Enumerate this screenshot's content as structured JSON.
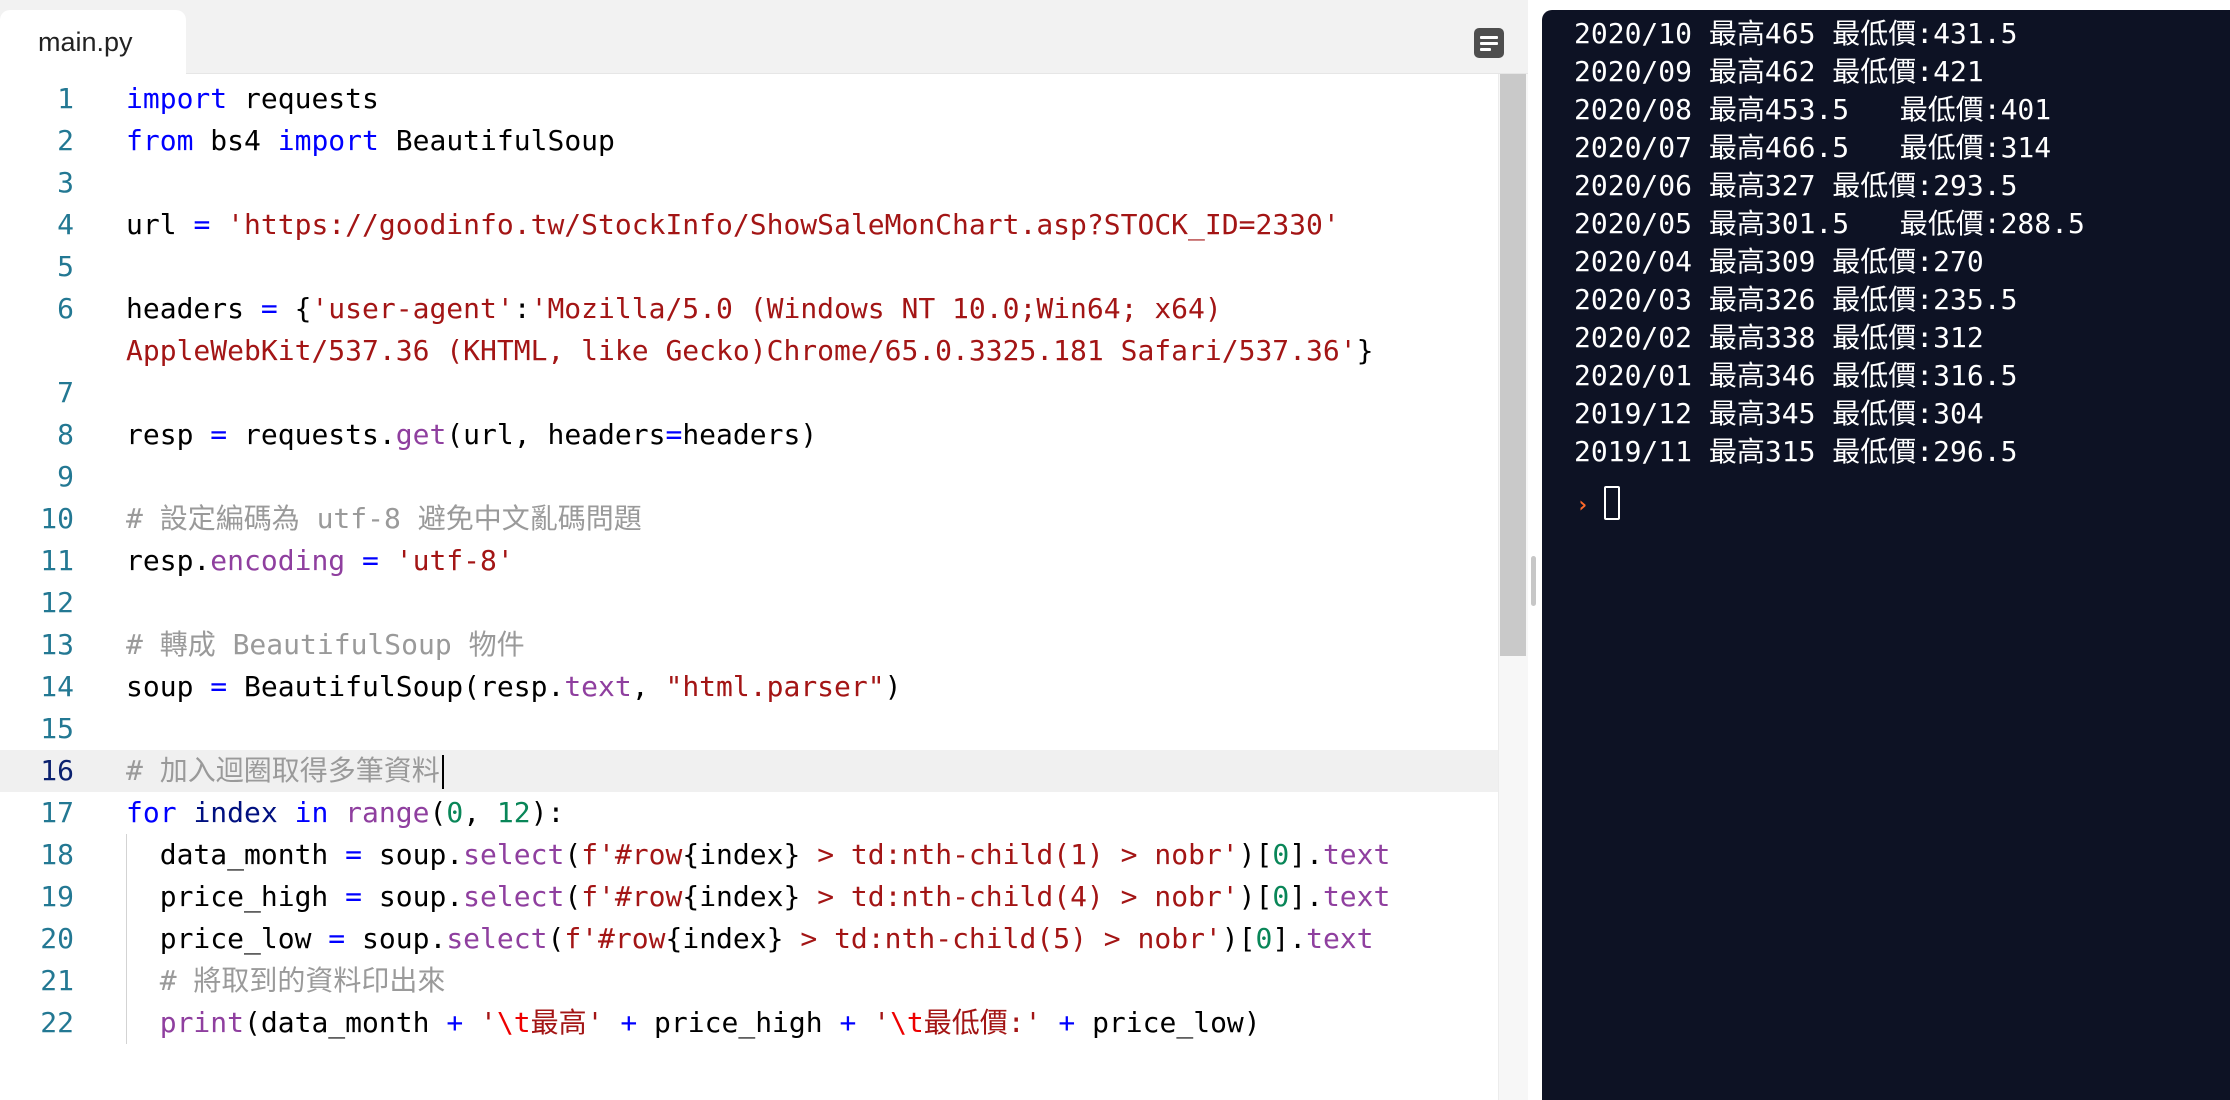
{
  "editor": {
    "tab_label": "main.py",
    "menu_icon": "panel-menu-icon"
  },
  "code": {
    "lines": [
      {
        "n": "1",
        "html": "<span class='kw'>import</span> requests"
      },
      {
        "n": "2",
        "html": "<span class='kw'>from</span> bs4 <span class='kw'>import</span> BeautifulSoup"
      },
      {
        "n": "3",
        "html": ""
      },
      {
        "n": "4",
        "html": "url <span class='op'>=</span> <span class='str'>'https://goodinfo.tw/StockInfo/ShowSaleMonChart.asp?STOCK_ID=2330'</span>"
      },
      {
        "n": "5",
        "html": ""
      },
      {
        "n": "6",
        "html": "headers <span class='op'>=</span> {<span class='str'>'user-agent'</span>:<span class='str'>'Mozilla/5.0 (Windows NT 10.0;Win64; x64)</span>"
      },
      {
        "n": "",
        "html": "<span class='str'>AppleWebKit/537.36 (KHTML, like Gecko)Chrome/65.0.3325.181 Safari/537.36'</span>}"
      },
      {
        "n": "7",
        "html": ""
      },
      {
        "n": "8",
        "html": "resp <span class='op'>=</span> requests.<span class='purple'>get</span>(url, headers<span class='op'>=</span>headers)"
      },
      {
        "n": "9",
        "html": ""
      },
      {
        "n": "10",
        "html": "<span class='cmt'># 設定編碼為 utf-8 避免中文亂碼問題</span>"
      },
      {
        "n": "11",
        "html": "resp.<span class='purple'>encoding</span> <span class='op'>=</span> <span class='str'>'utf-8'</span>"
      },
      {
        "n": "12",
        "html": ""
      },
      {
        "n": "13",
        "html": "<span class='cmt'># 轉成 BeautifulSoup 物件</span>"
      },
      {
        "n": "14",
        "html": "soup <span class='op'>=</span> BeautifulSoup(resp.<span class='purple'>text</span>, <span class='str'>\"html.parser\"</span>)"
      },
      {
        "n": "15",
        "html": ""
      },
      {
        "n": "16",
        "html": "<span class='cmt'># 加入迴圈取得多筆資料</span><span id='cursor' data-name='text-cursor' data-interactable='false'></span>",
        "active": true
      },
      {
        "n": "17",
        "html": "<span class='kw'>for</span> <span class='var'>index</span> <span class='kw'>in</span> <span class='purple'>range</span>(<span class='num'>0</span>, <span class='num'>12</span>):"
      },
      {
        "n": "18",
        "html": "  data_month <span class='op'>=</span> soup.<span class='purple'>select</span>(<span class='str'>f'#row</span>{index}<span class='str'> &gt; td:nth-child(1) &gt; nobr'</span>)[<span class='num'>0</span>].<span class='purple'>text</span>",
        "guide": true
      },
      {
        "n": "19",
        "html": "  price_high <span class='op'>=</span> soup.<span class='purple'>select</span>(<span class='str'>f'#row</span>{index}<span class='str'> &gt; td:nth-child(4) &gt; nobr'</span>)[<span class='num'>0</span>].<span class='purple'>text</span>",
        "guide": true
      },
      {
        "n": "20",
        "html": "  price_low <span class='op'>=</span> soup.<span class='purple'>select</span>(<span class='str'>f'#row</span>{index}<span class='str'> &gt; td:nth-child(5) &gt; nobr'</span>)[<span class='num'>0</span>].<span class='purple'>text</span>",
        "guide": true
      },
      {
        "n": "21",
        "html": "  <span class='cmt'># 將取到的資料印出來</span>",
        "guide": true
      },
      {
        "n": "22",
        "html": "  <span class='purple'>print</span>(data_month <span class='op'>+</span> <span class='str'>'<span class=\"esc\">\\t</span>最高'</span> <span class='op'>+</span> price_high <span class='op'>+</span> <span class='str'>'<span class=\"esc\">\\t</span>最低價:'</span> <span class='op'>+</span> price_low)",
        "guide": true
      }
    ]
  },
  "console": {
    "lines": [
      "2020/10 最高465 最低價:431.5",
      "2020/09 最高462 最低價:421",
      "2020/08 最高453.5   最低價:401",
      "2020/07 最高466.5   最低價:314",
      "2020/06 最高327 最低價:293.5",
      "2020/05 最高301.5   最低價:288.5",
      "2020/04 最高309 最低價:270",
      "2020/03 最高326 最低價:235.5",
      "2020/02 最高338 最低價:312",
      "2020/01 最高346 最低價:316.5",
      "2019/12 最高345 最低價:304",
      "2019/11 最高315 最低價:296.5"
    ],
    "prompt_symbol": "›"
  }
}
